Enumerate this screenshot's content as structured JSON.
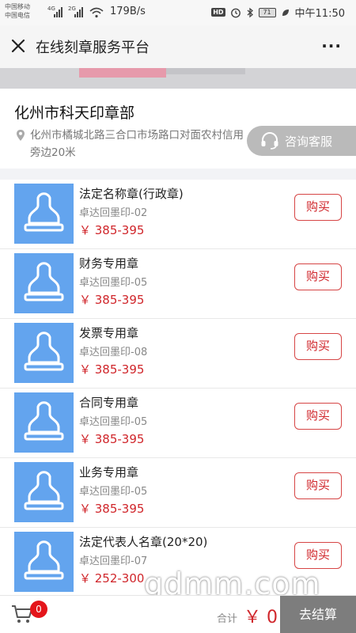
{
  "status_bar": {
    "carrier1": "中国移动",
    "carrier2": "中国电信",
    "net1": "4G",
    "net2": "2G",
    "speed": "179B/s",
    "hd": "HD",
    "battery": "71",
    "time": "中午11:50"
  },
  "header": {
    "title": "在线刻章服务平台",
    "more": "···"
  },
  "shop": {
    "name": "化州市科天印章部",
    "address_line1": "化州市橘城北路三合口市场路口对面农村信用",
    "address_line2": "旁边20米",
    "consult_label": "咨询客服"
  },
  "products": [
    {
      "name": "法定名称章(行政章)",
      "sub": "卓达回墨印-02",
      "price": "￥ 385-395",
      "buy": "购买"
    },
    {
      "name": "财务专用章",
      "sub": "卓达回墨印-05",
      "price": "￥ 385-395",
      "buy": "购买"
    },
    {
      "name": "发票专用章",
      "sub": "卓达回墨印-08",
      "price": "￥ 385-395",
      "buy": "购买"
    },
    {
      "name": "合同专用章",
      "sub": "卓达回墨印-05",
      "price": "￥ 385-395",
      "buy": "购买"
    },
    {
      "name": "业务专用章",
      "sub": "卓达回墨印-05",
      "price": "￥ 385-395",
      "buy": "购买"
    },
    {
      "name": "法定代表人名章(20*20)",
      "sub": "卓达回墨印-07",
      "price": "￥ 252-300",
      "buy": "购买"
    }
  ],
  "watermark": "gdmm.com",
  "footer": {
    "cart_count": "0",
    "total_label": "合计",
    "total_value": "￥ 0",
    "checkout": "去结算"
  },
  "colors": {
    "accent_red": "#d0262b",
    "thumb_blue": "#63a4ee",
    "checkout_grey": "#7d7d7d"
  },
  "icons": [
    "close-icon",
    "more-icon",
    "location-pin-icon",
    "headset-icon",
    "stamp-icon",
    "cart-icon",
    "wifi-icon"
  ]
}
